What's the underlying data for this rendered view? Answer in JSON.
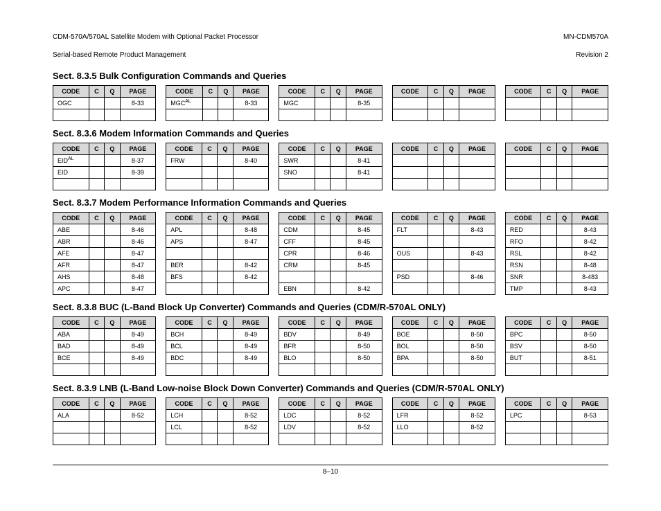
{
  "header": {
    "left_line1": "CDM-570A/570AL Satellite Modem with Optional Packet Processor",
    "left_line2": "Serial-based Remote Product Management",
    "right_line1": "MN-CDM570A",
    "right_line2": "Revision 2"
  },
  "columns": {
    "code": "CODE",
    "c": "C",
    "q": "Q",
    "page": "PAGE"
  },
  "sections": [
    {
      "title": "Sect. 8.3.5 Bulk Configuration Commands and Queries",
      "rows_per_table": 2,
      "tables": [
        [
          {
            "code": "OGC",
            "c": "",
            "q": "",
            "page": "8-33"
          }
        ],
        [
          {
            "code": "MGC",
            "sup": "AL",
            "c": "",
            "q": "",
            "page": "8-33"
          }
        ],
        [
          {
            "code": "MGC",
            "c": "",
            "q": "",
            "page": "8-35"
          }
        ],
        [],
        []
      ]
    },
    {
      "title": "Sect. 8.3.6 Modem Information Commands and Queries",
      "rows_per_table": 3,
      "tables": [
        [
          {
            "code": "EID",
            "sup": "AL",
            "c": "",
            "q": "",
            "page": "8-37"
          },
          {
            "code": "EID",
            "c": "",
            "q": "",
            "page": "8-39"
          }
        ],
        [
          {
            "code": "FRW",
            "c": "",
            "q": "",
            "page": "8-40"
          }
        ],
        [
          {
            "code": "SWR",
            "c": "",
            "q": "",
            "page": "8-41"
          },
          {
            "code": "SNO",
            "c": "",
            "q": "",
            "page": "8-41"
          }
        ],
        [],
        []
      ]
    },
    {
      "title": "Sect. 8.3.7 Modem Performance Information Commands and Queries",
      "rows_per_table": 6,
      "tables": [
        [
          {
            "code": "ABE",
            "c": "",
            "q": "",
            "page": "8-46"
          },
          {
            "code": "ABR",
            "c": "",
            "q": "",
            "page": "8-46"
          },
          {
            "code": "AFE",
            "c": "",
            "q": "",
            "page": "8-47"
          },
          {
            "code": "AFR",
            "c": "",
            "q": "",
            "page": "8-47"
          },
          {
            "code": "AHS",
            "c": "",
            "q": "",
            "page": "8-48"
          },
          {
            "code": "APC",
            "c": "",
            "q": "",
            "page": "8-47"
          }
        ],
        [
          {
            "code": "APL",
            "c": "",
            "q": "",
            "page": "8-48"
          },
          {
            "code": "APS",
            "c": "",
            "q": "",
            "page": "8-47"
          },
          null,
          {
            "code": "BER",
            "c": "",
            "q": "",
            "page": "8-42"
          },
          {
            "code": "BFS",
            "c": "",
            "q": "",
            "page": "8-42"
          }
        ],
        [
          {
            "code": "CDM",
            "c": "",
            "q": "",
            "page": "8-45"
          },
          {
            "code": "CFF",
            "c": "",
            "q": "",
            "page": "8-45"
          },
          {
            "code": "CPR",
            "c": "",
            "q": "",
            "page": "8-46"
          },
          {
            "code": "CRM",
            "c": "",
            "q": "",
            "page": "8-45"
          },
          null,
          {
            "code": "EBN",
            "c": "",
            "q": "",
            "page": "8-42"
          }
        ],
        [
          {
            "code": "FLT",
            "c": "",
            "q": "",
            "page": "8-43"
          },
          null,
          {
            "code": "OUS",
            "c": "",
            "q": "",
            "page": "8-43"
          },
          null,
          {
            "code": "PSD",
            "c": "",
            "q": "",
            "page": "8-46"
          }
        ],
        [
          {
            "code": "RED",
            "c": "",
            "q": "",
            "page": "8-43"
          },
          {
            "code": "RFO",
            "c": "",
            "q": "",
            "page": "8-42"
          },
          {
            "code": "RSL",
            "c": "",
            "q": "",
            "page": "8-42"
          },
          {
            "code": "RSN",
            "c": "",
            "q": "",
            "page": "8-48"
          },
          {
            "code": "SNR",
            "c": "",
            "q": "",
            "page": "8-483"
          },
          {
            "code": "TMP",
            "c": "",
            "q": "",
            "page": "8-43"
          }
        ]
      ]
    },
    {
      "title": "Sect. 8.3.8 BUC  (L-Band Block Up Converter) Commands and Queries (CDM/R-570AL ONLY)",
      "rows_per_table": 4,
      "tables": [
        [
          {
            "code": "ABA",
            "c": "",
            "q": "",
            "page": "8-49"
          },
          {
            "code": "BAD",
            "c": "",
            "q": "",
            "page": "8-49"
          },
          {
            "code": "BCE",
            "c": "",
            "q": "",
            "page": "8-49"
          }
        ],
        [
          {
            "code": "BCH",
            "c": "",
            "q": "",
            "page": "8-49"
          },
          {
            "code": "BCL",
            "c": "",
            "q": "",
            "page": "8-49"
          },
          {
            "code": "BDC",
            "c": "",
            "q": "",
            "page": "8-49"
          }
        ],
        [
          {
            "code": "BDV",
            "c": "",
            "q": "",
            "page": "8-49"
          },
          {
            "code": "BFR",
            "c": "",
            "q": "",
            "page": "8-50"
          },
          {
            "code": "BLO",
            "c": "",
            "q": "",
            "page": "8-50"
          }
        ],
        [
          {
            "code": "BOE",
            "c": "",
            "q": "",
            "page": "8-50"
          },
          {
            "code": "BOL",
            "c": "",
            "q": "",
            "page": "8-50"
          },
          {
            "code": "BPA",
            "c": "",
            "q": "",
            "page": "8-50"
          }
        ],
        [
          {
            "code": "BPC",
            "c": "",
            "q": "",
            "page": "8-50"
          },
          {
            "code": "BSV",
            "c": "",
            "q": "",
            "page": "8-50"
          },
          {
            "code": "BUT",
            "c": "",
            "q": "",
            "page": "8-51"
          }
        ]
      ]
    },
    {
      "title": "Sect. 8.3.9 LNB  (L-Band Low-noise Block Down Converter) Commands and Queries (CDM/R-570AL ONLY)",
      "rows_per_table": 3,
      "tables": [
        [
          {
            "code": "ALA",
            "c": "",
            "q": "",
            "page": "8-52"
          }
        ],
        [
          {
            "code": "LCH",
            "c": "",
            "q": "",
            "page": "8-52"
          },
          {
            "code": "LCL",
            "c": "",
            "q": "",
            "page": "8-52"
          }
        ],
        [
          {
            "code": "LDC",
            "c": "",
            "q": "",
            "page": "8-52"
          },
          {
            "code": "LDV",
            "c": "",
            "q": "",
            "page": "8-52"
          }
        ],
        [
          {
            "code": "LFR",
            "c": "",
            "q": "",
            "page": "8-52"
          },
          {
            "code": "LLO",
            "c": "",
            "q": "",
            "page": "8-52"
          }
        ],
        [
          {
            "code": "LPC",
            "c": "",
            "q": "",
            "page": "8-53"
          }
        ]
      ]
    }
  ],
  "footer": {
    "page_number": "8–10"
  }
}
